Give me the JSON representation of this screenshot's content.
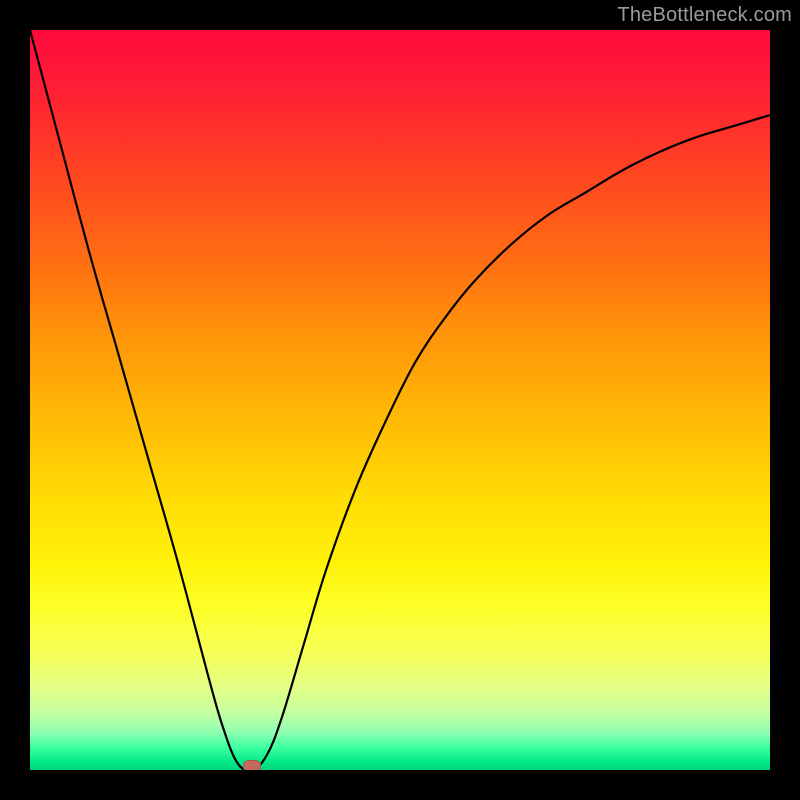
{
  "watermark": "TheBottleneck.com",
  "chart_data": {
    "type": "line",
    "title": "",
    "xlabel": "",
    "ylabel": "",
    "xlim": [
      0,
      100
    ],
    "ylim": [
      0,
      100
    ],
    "grid": false,
    "series": [
      {
        "name": "bottleneck-curve",
        "x": [
          0,
          4,
          8,
          12,
          16,
          20,
          24,
          26,
          28,
          30,
          32,
          34,
          37,
          40,
          44,
          48,
          52,
          56,
          60,
          65,
          70,
          75,
          80,
          85,
          90,
          95,
          100
        ],
        "y": [
          100,
          85,
          70,
          56,
          42,
          28,
          13,
          6,
          1,
          0,
          2,
          7,
          17,
          27,
          38,
          47,
          55,
          61,
          66,
          71,
          75,
          78,
          81,
          83.5,
          85.5,
          87,
          88.5
        ]
      }
    ],
    "annotations": [
      {
        "name": "min-marker",
        "x": 30,
        "y": 0
      }
    ],
    "colors": {
      "curve": "#000000",
      "marker": "#c36a5d",
      "gradient_top": "#ff0a3c",
      "gradient_bottom": "#00d480"
    }
  }
}
